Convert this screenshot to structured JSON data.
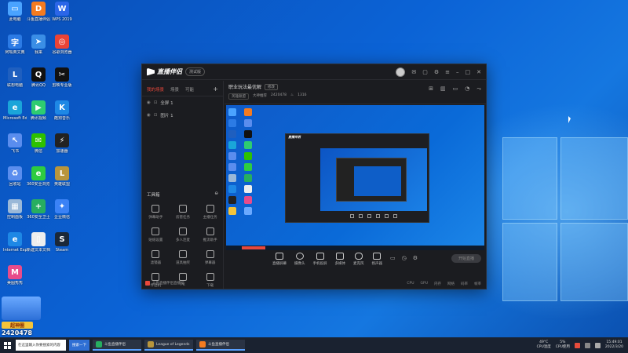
{
  "desktop_icons": [
    {
      "label": "此电脑",
      "icon": "computer-icon",
      "color": "#4aa3ff"
    },
    {
      "label": "斗鱼直播伴侣",
      "icon": "douyu-icon",
      "color": "#f47b20"
    },
    {
      "label": "WPS 2019",
      "icon": "wps-icon",
      "color": "#2b66e8"
    },
    {
      "label": "阿呱英文典",
      "icon": "dict-icon",
      "color": "#2c7be5"
    },
    {
      "label": "我来",
      "icon": "bird-icon",
      "color": "#3a8ee6"
    },
    {
      "label": "谷歌浏览器",
      "icon": "chrome-icon",
      "color": "#ea4335"
    },
    {
      "label": "联想电脑",
      "icon": "lenovo-icon",
      "color": "#1f5fbf"
    },
    {
      "label": "腾讯QQ",
      "icon": "qq-icon",
      "color": "#111111"
    },
    {
      "label": "剪映专业版",
      "icon": "capcut-icon",
      "color": "#111111"
    },
    {
      "label": "Microsoft Edge",
      "icon": "edge-icon",
      "color": "#1aa5d9"
    },
    {
      "label": "腾讯视频",
      "icon": "tencent-video-icon",
      "color": "#2ecc71"
    },
    {
      "label": "酷狗音乐",
      "icon": "kugou-icon",
      "color": "#1e88e5"
    },
    {
      "label": "飞书",
      "icon": "cursor-app-icon",
      "color": "#5a8dee"
    },
    {
      "label": "微信",
      "icon": "wechat-icon",
      "color": "#2dc100"
    },
    {
      "label": "加速器",
      "icon": "booster-icon",
      "color": "#222222"
    },
    {
      "label": "回收站",
      "icon": "recycle-icon",
      "color": "#5a8dee"
    },
    {
      "label": "360安全浏览器",
      "icon": "360-browser-icon",
      "color": "#2ecc40"
    },
    {
      "label": "英雄联盟",
      "icon": "lol-icon",
      "color": "#b8953c"
    },
    {
      "label": "控制面板",
      "icon": "control-panel-icon",
      "color": "#9ab8d8"
    },
    {
      "label": "360安全卫士",
      "icon": "360-guard-icon",
      "color": "#27ae60"
    },
    {
      "label": "企业微信",
      "icon": "wecom-icon",
      "color": "#3b82f6"
    },
    {
      "label": "Internet Explorer",
      "icon": "ie-icon",
      "color": "#1e88e5"
    },
    {
      "label": "新建文本文档",
      "icon": "file-icon",
      "color": "#eeeeee"
    },
    {
      "label": "Steam",
      "icon": "steam-icon",
      "color": "#1b2838"
    },
    {
      "label": "美图秀秀",
      "icon": "meitu-icon",
      "color": "#e74c8b"
    }
  ],
  "app": {
    "title": "直播伴侣",
    "beta": "测试版",
    "left_tabs": [
      "我的场景",
      "场景",
      "可能"
    ],
    "scenes": [
      {
        "name": "全屏 1"
      },
      {
        "name": "图片 1"
      }
    ],
    "tools_title": "工具箱",
    "tools": [
      "弹幕助手",
      "房管任务",
      "主播任务",
      "贴纸设置",
      "多人连麦",
      "推流助手",
      "滤镜器",
      "道具抽奖",
      "弹幕器",
      "伴侣机",
      "PK",
      "下载"
    ],
    "live_notice": "斗鱼直播伴侣直播间",
    "room_title": "职业玩法最优解",
    "room_tag": "修改",
    "room_meta": {
      "category": "英雄联盟",
      "quality": "大神推荐",
      "room_id": "2420478",
      "followers": "1316"
    },
    "controls": [
      "直播屏幕",
      "摄像头",
      "手机投屏",
      "多媒体",
      "麦克风",
      "扬声器"
    ],
    "start_live": "开始直播",
    "status": [
      "CPU",
      "GPU",
      "内存",
      "网络",
      "码率",
      "帧率"
    ]
  },
  "stream_overlay": {
    "badge": "超神圈",
    "room_id": "2420478"
  },
  "taskbar": {
    "search_placeholder": "在这里输入你要搜索的内容",
    "quick_button": "搜索一下",
    "tasks": [
      {
        "label": "斗鱼直播伴侣",
        "color": "#27ae60"
      },
      {
        "label": "League of Legends",
        "color": "#b8953c"
      },
      {
        "label": "斗鱼直播伴侣",
        "color": "#f47b20"
      }
    ],
    "weather_temp": "49°C",
    "weather_label": "CPU温度",
    "cpu_usage": "5%",
    "cpu_label": "CPU使用",
    "time": "15:49:01",
    "date": "2022/3/20"
  }
}
